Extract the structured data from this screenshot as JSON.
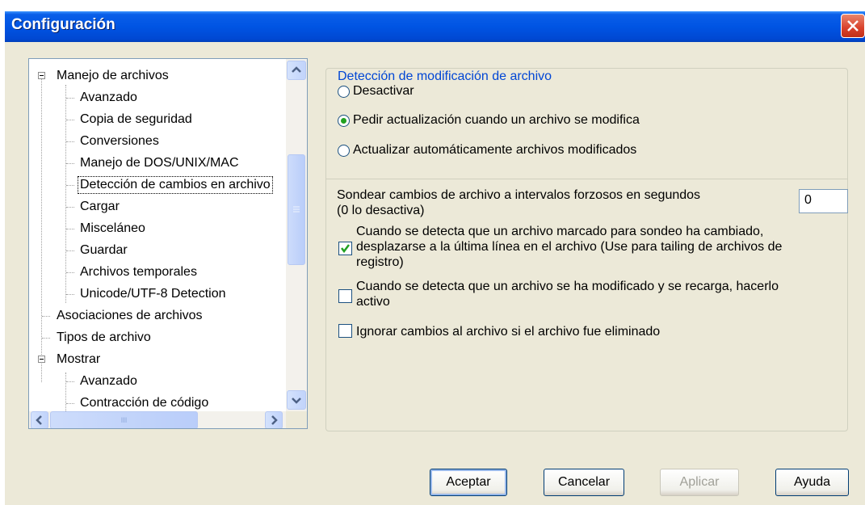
{
  "window": {
    "title": "Configuración"
  },
  "tree": {
    "items": [
      {
        "label": "Manejo de archivos"
      },
      {
        "label": "Avanzado"
      },
      {
        "label": "Copia de seguridad"
      },
      {
        "label": "Conversiones"
      },
      {
        "label": "Manejo de DOS/UNIX/MAC"
      },
      {
        "label": "Detección de cambios en archivo"
      },
      {
        "label": "Cargar"
      },
      {
        "label": "Misceláneo"
      },
      {
        "label": "Guardar"
      },
      {
        "label": "Archivos temporales"
      },
      {
        "label": "Unicode/UTF-8 Detection"
      },
      {
        "label": "Asociaciones de archivos"
      },
      {
        "label": "Tipos de archivo"
      },
      {
        "label": "Mostrar"
      },
      {
        "label": "Avanzado"
      },
      {
        "label": "Contracción de código"
      }
    ],
    "selected": "Detección de cambios en archivo",
    "hscroll_thumb_label": "III"
  },
  "detection": {
    "legend": "Detección de modificación de archivo",
    "options": [
      {
        "label": "Desactivar",
        "selected": false
      },
      {
        "label": "Pedir actualización cuando un archivo se modifica",
        "selected": true
      },
      {
        "label": "Actualizar automáticamente archivos modificados",
        "selected": false
      }
    ]
  },
  "polling": {
    "label_line1": "Sondear cambios de archivo a intervalos forzosos en segundos",
    "label_line2": "(0 lo desactiva)",
    "value": "0"
  },
  "checkboxes": [
    {
      "lines": [
        "Cuando se detecta que un archivo marcado para sondeo ha cambiado,",
        "desplazarse a la última línea en el archivo (Use para tailing de archivos de",
        "registro)"
      ],
      "checked": true
    },
    {
      "lines": [
        "Cuando se detecta que un archivo se ha modificado y se recarga, hacerlo",
        "activo"
      ],
      "checked": false
    },
    {
      "lines": [
        "Ignorar  cambios al archivo si el archivo fue eliminado"
      ],
      "checked": false
    }
  ],
  "buttons": {
    "ok": "Aceptar",
    "cancel": "Cancelar",
    "apply": "Aplicar",
    "help": "Ayuda"
  }
}
